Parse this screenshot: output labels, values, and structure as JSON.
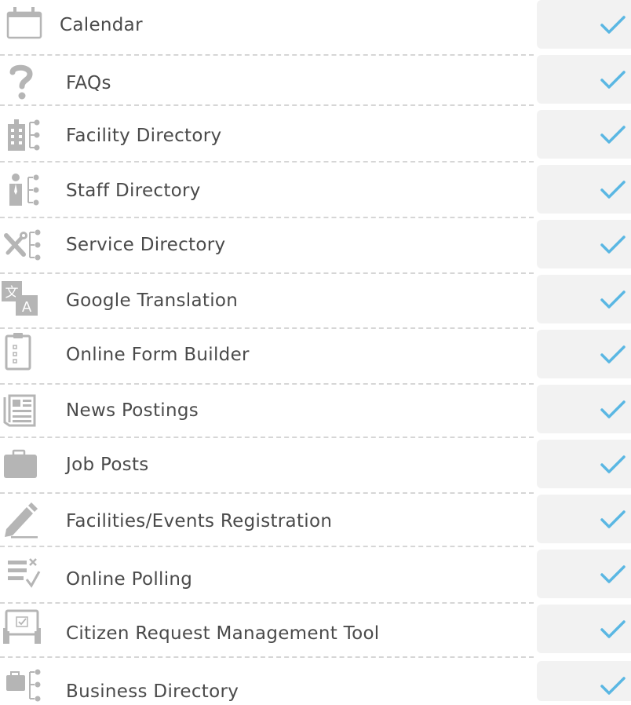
{
  "features": [
    {
      "label": "Calendar",
      "icon": "calendar-icon",
      "checked": true
    },
    {
      "label": "FAQs",
      "icon": "question-icon",
      "checked": true
    },
    {
      "label": "Facility Directory",
      "icon": "building-directory-icon",
      "checked": true
    },
    {
      "label": "Staff Directory",
      "icon": "staff-directory-icon",
      "checked": true
    },
    {
      "label": "Service Directory",
      "icon": "tools-directory-icon",
      "checked": true
    },
    {
      "label": "Google Translation",
      "icon": "translate-icon",
      "checked": true
    },
    {
      "label": "Online Form Builder",
      "icon": "clipboard-icon",
      "checked": true
    },
    {
      "label": "News Postings",
      "icon": "newspaper-icon",
      "checked": true
    },
    {
      "label": "Job Posts",
      "icon": "briefcase-icon",
      "checked": true
    },
    {
      "label": "Facilities/Events Registration",
      "icon": "pencil-icon",
      "checked": true
    },
    {
      "label": "Online Polling",
      "icon": "poll-icon",
      "checked": true
    },
    {
      "label": "Citizen Request Management Tool",
      "icon": "request-board-icon",
      "checked": true
    },
    {
      "label": "Business Directory",
      "icon": "business-directory-icon",
      "checked": true
    }
  ],
  "colors": {
    "icon": "#b5b5b5",
    "check": "#5ab7e3",
    "cell_bg": "#f2f2f2",
    "divider": "#d6d6d6",
    "text": "#4a4a4a"
  }
}
